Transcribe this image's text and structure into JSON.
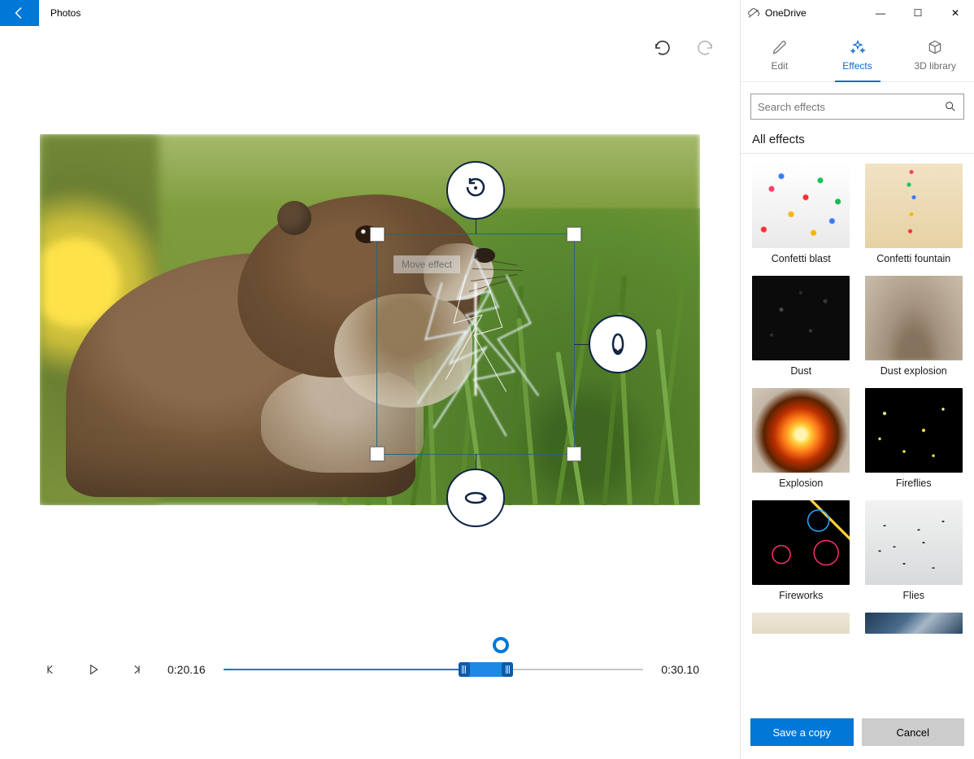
{
  "app": {
    "title": "Photos"
  },
  "onedrive": {
    "label": "OneDrive"
  },
  "tabs": {
    "edit": "Edit",
    "effects": "Effects",
    "library3d": "3D library",
    "active": "effects"
  },
  "search": {
    "placeholder": "Search effects"
  },
  "section": {
    "all_effects": "All effects"
  },
  "effects": [
    {
      "label": "Confetti blast"
    },
    {
      "label": "Confetti fountain"
    },
    {
      "label": "Dust"
    },
    {
      "label": "Dust explosion"
    },
    {
      "label": "Explosion"
    },
    {
      "label": "Fireflies"
    },
    {
      "label": "Fireworks"
    },
    {
      "label": "Flies"
    }
  ],
  "overlay": {
    "tooltip": "Move effect"
  },
  "timeline": {
    "current": "0:20.16",
    "duration": "0:30.10",
    "fill_percent": 66,
    "clip_start_percent": 56,
    "clip_end_percent": 69,
    "playhead_percent": 66
  },
  "footer": {
    "save": "Save a copy",
    "cancel": "Cancel"
  }
}
